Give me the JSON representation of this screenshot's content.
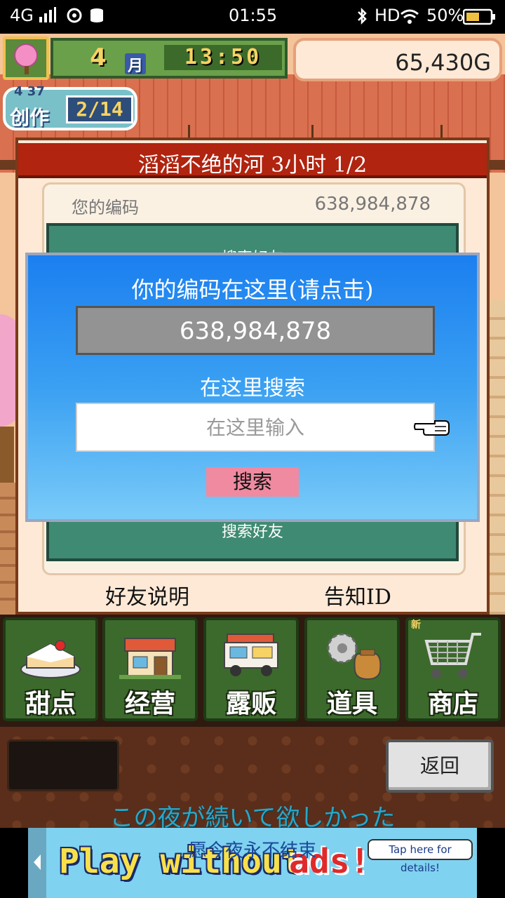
{
  "status_bar": {
    "network": "4G",
    "time": "01:55",
    "hd": "HD",
    "battery": "50%"
  },
  "hud": {
    "month_number": "4",
    "month_unit": "月",
    "clock": "13:50",
    "money": "65,430G",
    "create_small_number": "4 37",
    "create_label": "创作",
    "create_count": "2/14"
  },
  "panel": {
    "title": "滔滔不绝的河  3小时 1/2",
    "code_label": "您的编码",
    "code_value": "638,984,878",
    "search_friend_label": "搜索好友",
    "friend_description_button": "好友说明",
    "notify_id_button": "告知ID"
  },
  "dialog": {
    "title": "你的编码在这里(请点击)",
    "code": "638,984,878",
    "search_label": "在这里搜索",
    "input_placeholder": "在这里输入",
    "input_value": "",
    "search_button": "搜索"
  },
  "menu": [
    {
      "label": "甜点",
      "icon": "cake-icon"
    },
    {
      "label": "经营",
      "icon": "shop-building-icon"
    },
    {
      "label": "露贩",
      "icon": "food-truck-icon"
    },
    {
      "label": "道具",
      "icon": "gear-sack-icon"
    },
    {
      "label": "商店",
      "icon": "shopping-cart-icon",
      "badge": "新"
    }
  ],
  "bottom": {
    "back_button": "返回",
    "lyric_jp": "この夜が続いて欲しかった",
    "lyric_cn": "愿今夜永不结束"
  },
  "ad": {
    "text_main": "Play without",
    "text_red": "ads!",
    "tap": "Tap here for details!"
  },
  "colors": {
    "panel_title_red": "#b02410",
    "dialog_blue": "#1b7ff0",
    "search_button_pink": "#f08aa0",
    "menu_green": "#3c6a2c"
  }
}
